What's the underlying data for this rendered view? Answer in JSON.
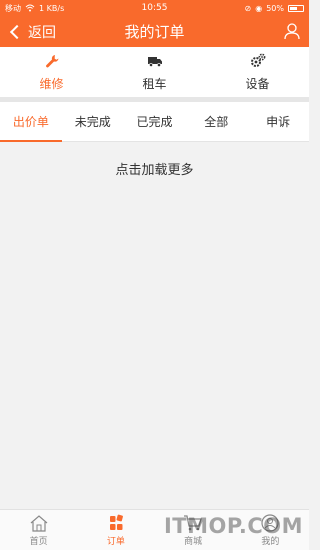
{
  "status_bar": {
    "carrier": "移动",
    "speed": "1 KB/s",
    "time": "10:55",
    "battery": "50%",
    "battery_level": 0.5
  },
  "nav": {
    "back_label": "返回",
    "title": "我的订单",
    "user_icon": "user-icon"
  },
  "categories": [
    {
      "label": "维修",
      "icon": "wrench-icon",
      "active": true
    },
    {
      "label": "租车",
      "icon": "truck-icon",
      "active": false
    },
    {
      "label": "设备",
      "icon": "gears-icon",
      "active": false
    }
  ],
  "tabs": [
    {
      "label": "出价单",
      "active": true
    },
    {
      "label": "未完成",
      "active": false
    },
    {
      "label": "已完成",
      "active": false
    },
    {
      "label": "全部",
      "active": false
    },
    {
      "label": "申诉",
      "active": false
    }
  ],
  "content": {
    "load_more": "点击加载更多"
  },
  "bottom_nav": [
    {
      "label": "首页",
      "icon": "home-icon",
      "active": false
    },
    {
      "label": "订单",
      "icon": "order-grid-icon",
      "active": true
    },
    {
      "label": "商城",
      "icon": "cart-icon",
      "active": false
    },
    {
      "label": "我的",
      "icon": "profile-icon",
      "active": false
    }
  ],
  "watermark": "ITMOP.COM",
  "colors": {
    "accent": "#f96a2c",
    "background": "#f2f2f2",
    "inactive": "#888888"
  }
}
